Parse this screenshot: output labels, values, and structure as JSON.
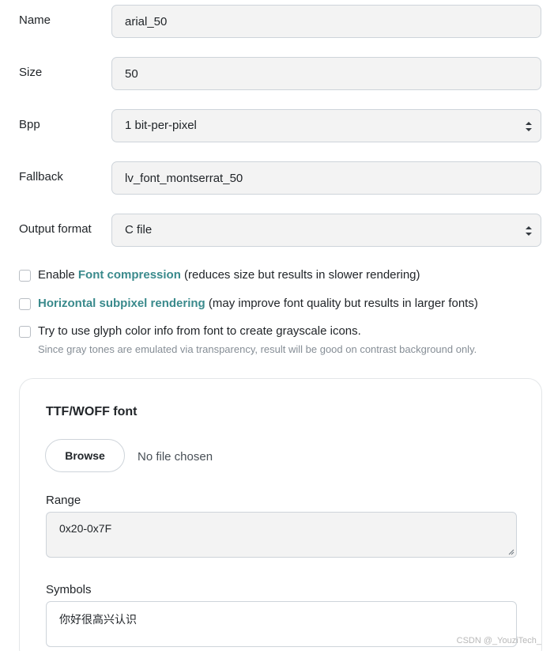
{
  "form": {
    "name": {
      "label": "Name",
      "value": "arial_50"
    },
    "size": {
      "label": "Size",
      "value": "50"
    },
    "bpp": {
      "label": "Bpp",
      "value": "1 bit-per-pixel"
    },
    "fallback": {
      "label": "Fallback",
      "value": "lv_font_montserrat_50"
    },
    "output_format": {
      "label": "Output format",
      "value": "C file"
    }
  },
  "options": {
    "compression": {
      "prefix": "Enable ",
      "link": "Font compression",
      "suffix": " (reduces size but results in slower rendering)",
      "checked": false
    },
    "subpixel": {
      "link": "Horizontal subpixel rendering",
      "suffix": " (may improve font quality but results in larger fonts)",
      "checked": false
    },
    "glyph_color": {
      "text": "Try to use glyph color info from font to create grayscale icons.",
      "hint": "Since gray tones are emulated via transparency, result will be good on contrast background only.",
      "checked": false
    }
  },
  "font_card": {
    "title": "TTF/WOFF font",
    "browse_label": "Browse",
    "file_status": "No file chosen",
    "range": {
      "label": "Range",
      "value": "0x20-0x7F"
    },
    "symbols": {
      "label": "Symbols",
      "value": "你好很高兴认识"
    }
  },
  "watermark": "CSDN @_YouziTech_",
  "colors": {
    "link": "#3a8a8c",
    "field_bg": "#f3f3f3",
    "border": "#ced4da",
    "hint": "#868e96"
  }
}
